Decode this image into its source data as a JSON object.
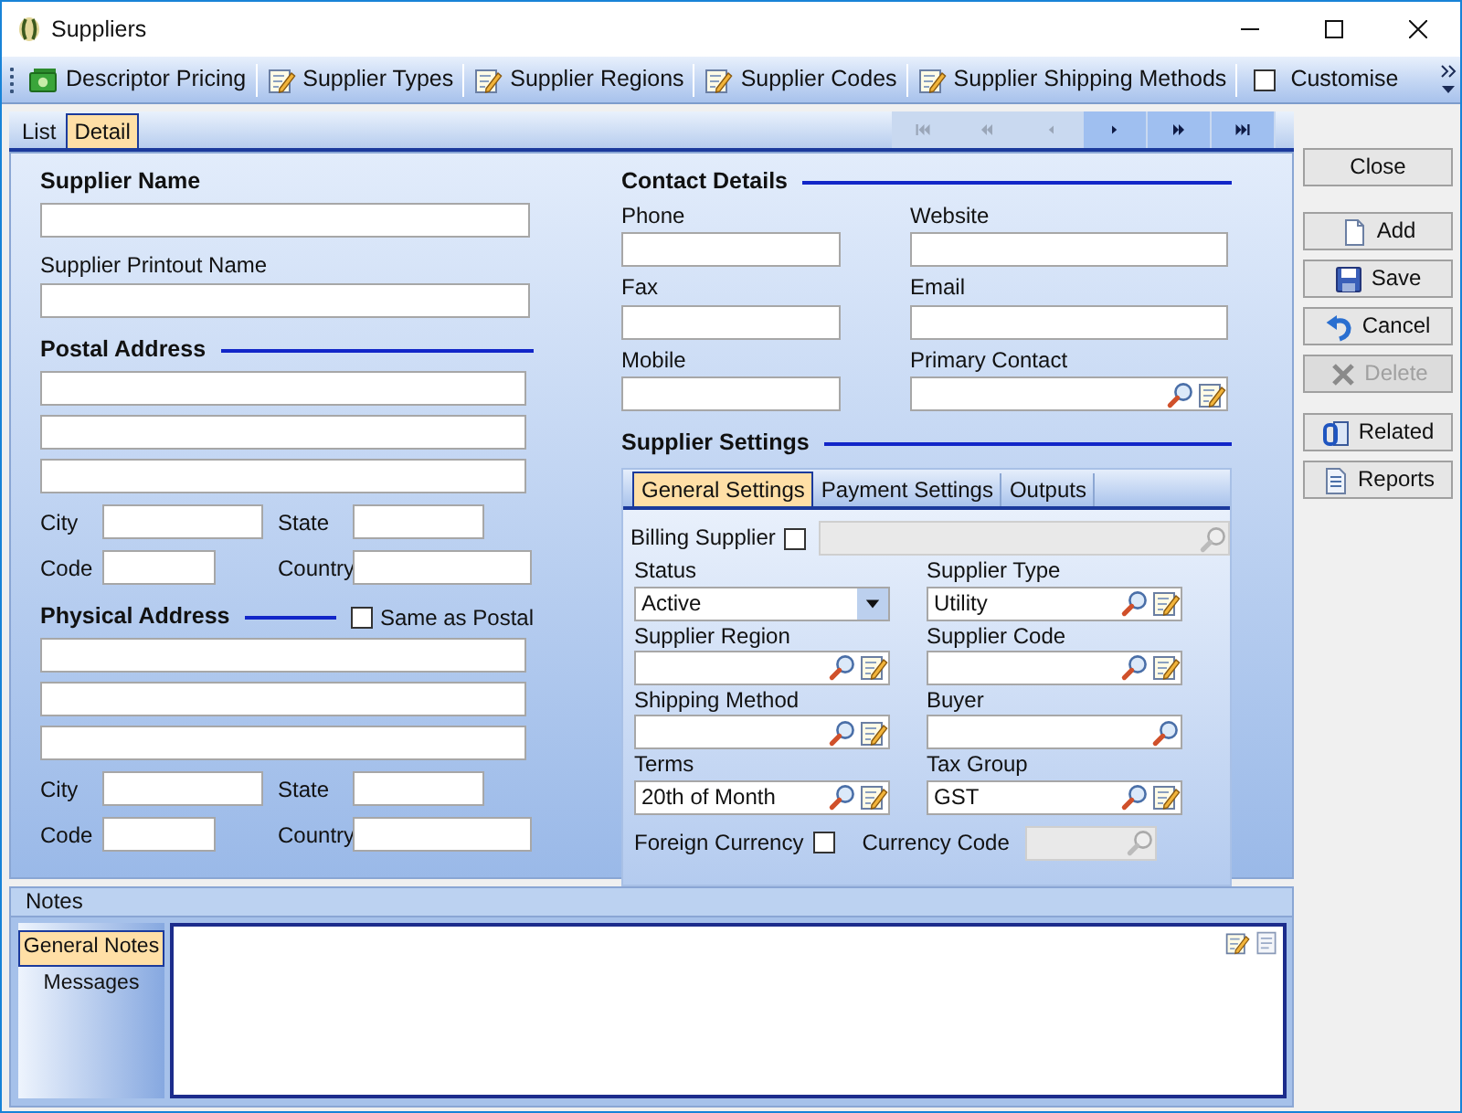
{
  "window": {
    "title": "Suppliers"
  },
  "toolbar": {
    "items": [
      {
        "label": "Descriptor Pricing",
        "kind": "pricing"
      },
      {
        "label": "Supplier Types",
        "kind": "edit"
      },
      {
        "label": "Supplier Regions",
        "kind": "edit"
      },
      {
        "label": "Supplier Codes",
        "kind": "edit"
      },
      {
        "label": "Supplier Shipping Methods",
        "kind": "edit"
      }
    ],
    "customise": {
      "label": "Customise",
      "checked": false
    }
  },
  "tabs": [
    {
      "label": "List",
      "selected": false
    },
    {
      "label": "Detail",
      "selected": true
    }
  ],
  "navigator": [
    {
      "kind": "first",
      "disabled": true
    },
    {
      "kind": "prev_page",
      "disabled": true
    },
    {
      "kind": "prev",
      "disabled": true
    },
    {
      "kind": "next",
      "disabled": false
    },
    {
      "kind": "next_page",
      "disabled": false
    },
    {
      "kind": "last",
      "disabled": false
    }
  ],
  "supplier": {
    "name_label": "Supplier Name",
    "printout_label": "Supplier Printout Name"
  },
  "postal_address": {
    "heading": "Postal Address",
    "city": "City",
    "state": "State",
    "code": "Code",
    "country": "Country"
  },
  "physical_address": {
    "heading": "Physical Address",
    "same_as_postal": {
      "label": "Same as Postal",
      "checked": false
    },
    "city": "City",
    "state": "State",
    "code": "Code",
    "country": "Country"
  },
  "contact_details": {
    "heading": "Contact Details",
    "fields": [
      {
        "label": "Phone",
        "kind": "text"
      },
      {
        "label": "Website",
        "kind": "text"
      },
      {
        "label": "Fax",
        "kind": "text"
      },
      {
        "label": "Email",
        "kind": "text"
      },
      {
        "label": "Mobile",
        "kind": "text"
      },
      {
        "label": "Primary Contact",
        "kind": "lookup_edit"
      }
    ]
  },
  "supplier_settings": {
    "heading": "Supplier Settings",
    "tabs": [
      {
        "label": "General Settings",
        "selected": true
      },
      {
        "label": "Payment Settings",
        "selected": false
      },
      {
        "label": "Outputs",
        "selected": false
      }
    ],
    "billing_supplier": {
      "label": "Billing Supplier",
      "checked": false,
      "field": {
        "kind": "lookup",
        "disabled": true
      }
    },
    "fields": [
      {
        "label": "Status",
        "kind": "dropdown",
        "value": "Active"
      },
      {
        "label": "Supplier Type",
        "kind": "lookup_edit",
        "value": "Utility"
      },
      {
        "label": "Supplier Region",
        "kind": "lookup_edit"
      },
      {
        "label": "Supplier Code",
        "kind": "lookup_edit"
      },
      {
        "label": "Shipping Method",
        "kind": "lookup_edit"
      },
      {
        "label": "Buyer",
        "kind": "lookup"
      },
      {
        "label": "Terms",
        "kind": "lookup_edit",
        "value": "20th of Month"
      },
      {
        "label": "Tax Group",
        "kind": "lookup_edit",
        "value": "GST"
      }
    ],
    "foreign_currency": {
      "label": "Foreign Currency",
      "checked": false
    },
    "currency_code": {
      "label": "Currency Code",
      "field": {
        "kind": "lookup",
        "disabled": true
      }
    }
  },
  "action_groups": [
    {
      "buttons": [
        {
          "label": "Close",
          "kind": "close",
          "disabled": false
        }
      ]
    },
    {
      "buttons": [
        {
          "label": "Add",
          "kind": "add",
          "disabled": false
        },
        {
          "label": "Save",
          "kind": "save",
          "disabled": false
        },
        {
          "label": "Cancel",
          "kind": "cancel",
          "disabled": false
        },
        {
          "label": "Delete",
          "kind": "delete",
          "disabled": true
        }
      ]
    },
    {
      "buttons": [
        {
          "label": "Related",
          "kind": "related",
          "disabled": false
        },
        {
          "label": "Reports",
          "kind": "reports",
          "disabled": false
        }
      ]
    }
  ],
  "notes": {
    "heading": "Notes",
    "tabs": [
      {
        "label": "General Notes",
        "selected": true
      },
      {
        "label": "Messages",
        "selected": false
      }
    ]
  }
}
